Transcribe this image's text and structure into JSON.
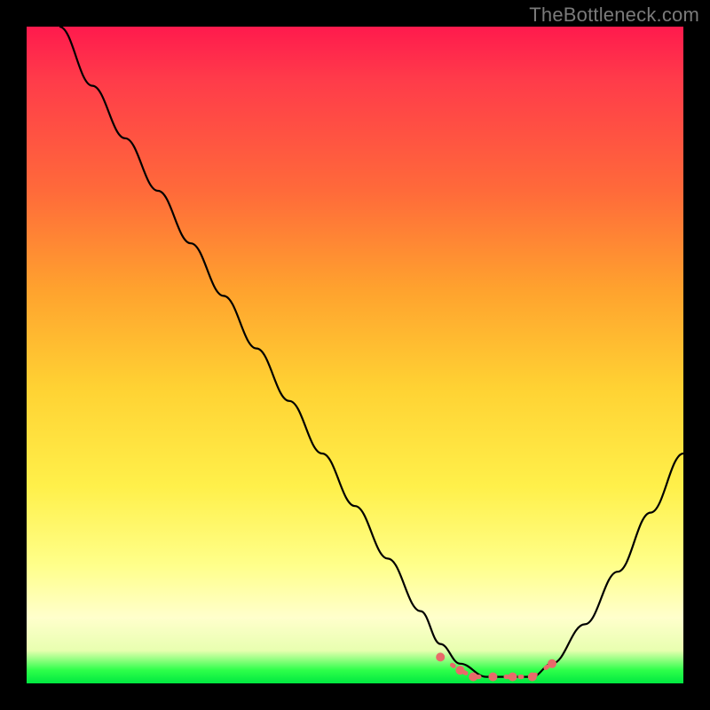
{
  "watermark": "TheBottleneck.com",
  "chart_data": {
    "type": "line",
    "title": "",
    "xlabel": "",
    "ylabel": "",
    "xlim": [
      0,
      100
    ],
    "ylim": [
      0,
      100
    ],
    "grid": false,
    "series": [
      {
        "name": "bottleneck-curve",
        "x": [
          5,
          10,
          15,
          20,
          25,
          30,
          35,
          40,
          45,
          50,
          55,
          60,
          63,
          66,
          70,
          74,
          77,
          80,
          85,
          90,
          95,
          100
        ],
        "y": [
          100,
          91,
          83,
          75,
          67,
          59,
          51,
          43,
          35,
          27,
          19,
          11,
          6,
          3,
          1,
          1,
          1,
          3,
          9,
          17,
          26,
          35
        ]
      }
    ],
    "markers": {
      "name": "bottom-dots",
      "color": "#e86a6a",
      "x": [
        63,
        66,
        68,
        71,
        74,
        77,
        80
      ],
      "y": [
        4,
        2,
        1,
        1,
        1,
        1,
        3
      ]
    },
    "background_gradient": {
      "stops": [
        {
          "pos": 0,
          "color": "#ff1a4d"
        },
        {
          "pos": 25,
          "color": "#ff6a3a"
        },
        {
          "pos": 55,
          "color": "#ffd233"
        },
        {
          "pos": 82,
          "color": "#ffff8a"
        },
        {
          "pos": 95,
          "color": "#e8ffb0"
        },
        {
          "pos": 100,
          "color": "#00e840"
        }
      ]
    }
  }
}
